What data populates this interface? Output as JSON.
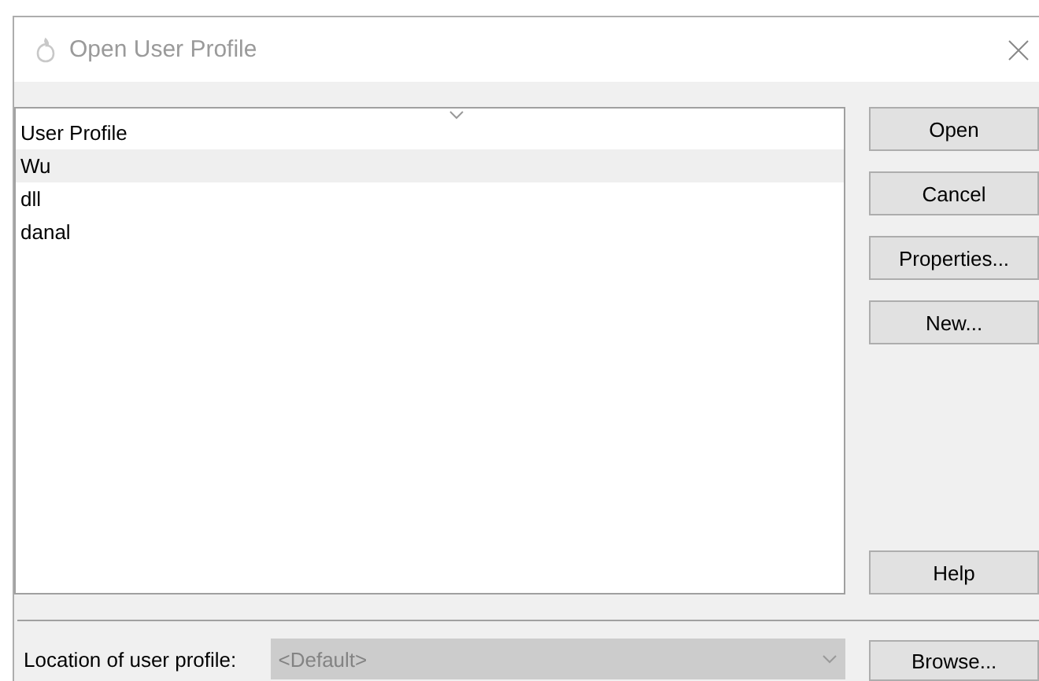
{
  "window": {
    "title": "Open User Profile"
  },
  "list": {
    "header": "User Profile",
    "rows": [
      {
        "name": "Wu",
        "selected": true
      },
      {
        "name": "dll",
        "selected": false
      },
      {
        "name": "danal",
        "selected": false
      }
    ]
  },
  "buttons": [
    "Open",
    "Cancel",
    "Properties...",
    "New..."
  ],
  "help_button": "Help",
  "location": {
    "label": "Location of user profile:",
    "value": "<Default>",
    "disabled": true
  },
  "browse_button": "Browse..."
}
